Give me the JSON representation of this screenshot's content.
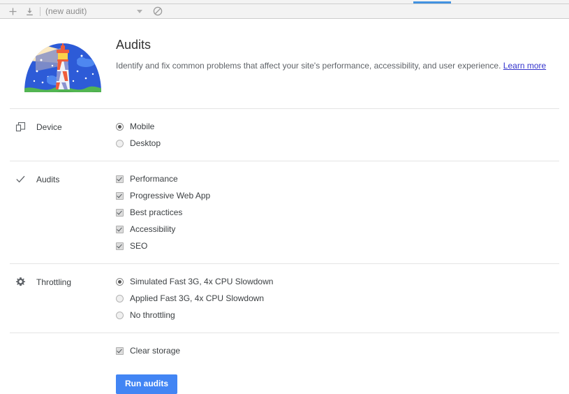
{
  "toolbar": {
    "add_icon": "plus-icon",
    "import_icon": "download-icon",
    "select_value": "(new audit)",
    "caret_icon": "chevron-down-icon",
    "clear_icon": "no-entry-icon"
  },
  "header": {
    "logo": "lighthouse-logo",
    "title": "Audits",
    "description": "Identify and fix common problems that affect your site's performance, accessibility, and user experience.",
    "learn_more": "Learn more"
  },
  "sections": {
    "device": {
      "icon": "devices-icon",
      "label": "Device",
      "options": [
        {
          "label": "Mobile",
          "checked": true
        },
        {
          "label": "Desktop",
          "checked": false
        }
      ]
    },
    "audits": {
      "icon": "check-icon",
      "label": "Audits",
      "options": [
        {
          "label": "Performance",
          "checked": true
        },
        {
          "label": "Progressive Web App",
          "checked": true
        },
        {
          "label": "Best practices",
          "checked": true
        },
        {
          "label": "Accessibility",
          "checked": true
        },
        {
          "label": "SEO",
          "checked": true
        }
      ]
    },
    "throttling": {
      "icon": "gear-icon",
      "label": "Throttling",
      "options": [
        {
          "label": "Simulated Fast 3G, 4x CPU Slowdown",
          "checked": true
        },
        {
          "label": "Applied Fast 3G, 4x CPU Slowdown",
          "checked": false
        },
        {
          "label": "No throttling",
          "checked": false
        }
      ]
    },
    "storage": {
      "clear_storage_label": "Clear storage",
      "clear_storage_checked": true,
      "run_button_label": "Run audits"
    }
  },
  "colors": {
    "accent_blue": "#4285f4",
    "tab_indicator": "#4292e0",
    "link_blue": "#3333cc",
    "toolbar_bg": "#f3f3f3"
  }
}
